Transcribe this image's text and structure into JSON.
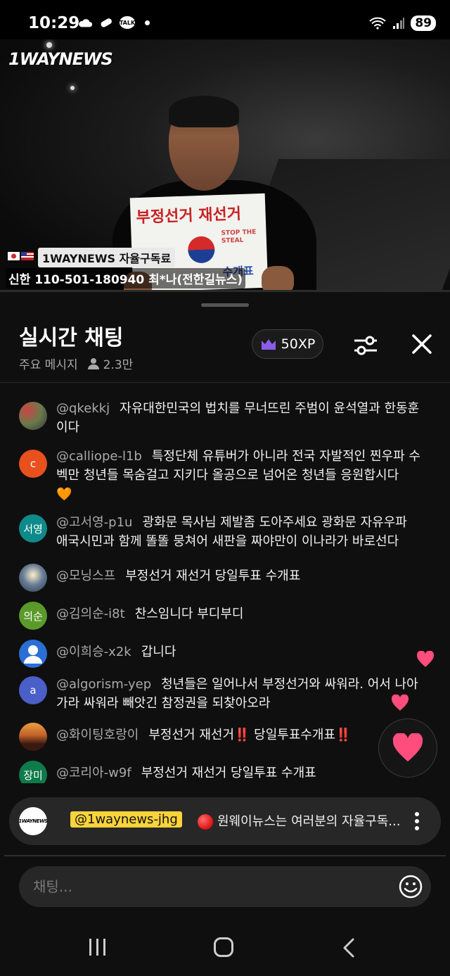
{
  "status_bar": {
    "time": "10:29",
    "talk_label": "TALK",
    "battery": "89"
  },
  "video": {
    "logo": "1WAYNEWS",
    "sign_text": "부정선거 재선거",
    "sign_stop": "STOP THE STEAL",
    "sign_bottom": "수개표",
    "subscribe_label": "1WAYNEWS 자율구독료",
    "account_text": "신한 110-501-180940 최*나(전한길뉴스)"
  },
  "chat_panel": {
    "title": "실시간 채팅",
    "mode_label": "주요 메시지",
    "viewer_count": "2.3만",
    "xp_label": "50XP"
  },
  "messages": [
    {
      "author": "@qkekkj",
      "text": "자유대한민국의 법치를 무너뜨린 주범이 윤석열과 한동훈이다",
      "avatar": "",
      "avatar_color": "#6a7a4a"
    },
    {
      "author": "@calliope-l1b",
      "text": "특정단체 유튜버가 아니라 전국 자발적인 찐우파 수벡만 청년들 목숨걸고 지키다 올공으로 넘어온 청년들 응원합시다",
      "emoji": "🧡",
      "avatar": "c",
      "avatar_color": "#e8501e"
    },
    {
      "author": "@고서영-p1u",
      "text": "광화문 목사님 제발좀 도아주세요 광화문 자유우파 애국시민과 함께 똘똘 뭉쳐어 새판을 짜야만이 이나라가 바로선다",
      "avatar": "서영",
      "avatar_color": "#0f8a8a"
    },
    {
      "author": "@모닝스프",
      "text": "부정선거 재선거 당일투표 수개표",
      "avatar": "",
      "avatar_color": "#8aa0b8"
    },
    {
      "author": "@김의순-i8t",
      "text": "찬스임니다 부디부디",
      "avatar": "의순",
      "avatar_color": "#5a9a2a"
    },
    {
      "author": "@이희승-x2k",
      "text": "갑니다",
      "avatar": "",
      "avatar_color": "#2a6fd6"
    },
    {
      "author": "@algorism-yep",
      "text": "청년들은 일어나서 부정선거와 싸워라. 어서 나아가라 싸워라 빼앗긴 참정권을 되찾아오라",
      "avatar": "a",
      "avatar_color": "#4a5fc8"
    },
    {
      "author": "@화이팅호랑이",
      "text": "부정선거 재선거‼️ 당일투표수개표‼️",
      "avatar": "",
      "avatar_color": "#c0602a"
    },
    {
      "author": "@코리아-w9f",
      "text": "부정선거 재선거 당일투표 수개표",
      "avatar": "장미",
      "avatar_color": "#0f7a4a"
    }
  ],
  "pinned": {
    "logo": "1WAYNEWS",
    "tag": "@1waynews-jhg",
    "text": "원웨이뉴스는 여러분의 자율구독..."
  },
  "input": {
    "placeholder": "채팅..."
  },
  "colors": {
    "heart": "#ff4d7d",
    "pin_tag": "#f8d33a",
    "xp_crown": "#8a5ce8"
  }
}
